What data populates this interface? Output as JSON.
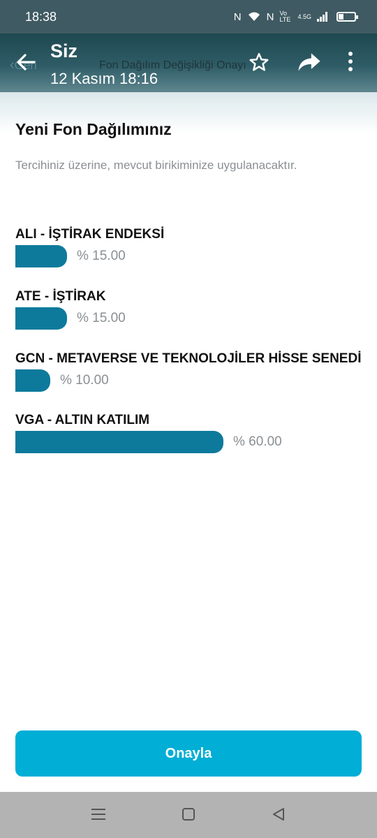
{
  "status_bar": {
    "time": "18:38",
    "nfc_label": "N",
    "network_label": "Vo LTE",
    "speed_label": "4.5G",
    "battery_level": "14"
  },
  "header": {
    "back_under_label": "Geri",
    "under_title": "Fon Dağılım Değişikliği Onayı",
    "sender": "Siz",
    "date": "12 Kasım 18:16"
  },
  "content": {
    "title": "Yeni Fon Dağılımınız",
    "description": "Tercihiniz üzerine, mevcut birikiminize uygulanacaktır.",
    "funds": [
      {
        "name": "ALI - İŞTİRAK ENDEKSİ",
        "percent_label": "% 15.00",
        "percent": 15
      },
      {
        "name": "ATE - İŞTİRAK",
        "percent_label": "% 15.00",
        "percent": 15
      },
      {
        "name": "GCN - METAVERSE VE TEKNOLOJİLER HİSSE SENEDİ",
        "percent_label": "% 10.00",
        "percent": 10
      },
      {
        "name": "VGA - ALTIN KATILIM",
        "percent_label": "% 60.00",
        "percent": 60
      }
    ]
  },
  "actions": {
    "confirm_label": "Onayla"
  },
  "icons": [
    "back-arrow-icon",
    "star-icon",
    "share-icon",
    "more-vert-icon",
    "menu-icon",
    "home-square-icon",
    "back-triangle-icon"
  ],
  "colors": {
    "header": "#2e5c66",
    "bar": "#0d7a9c",
    "button": "#00aed6"
  }
}
